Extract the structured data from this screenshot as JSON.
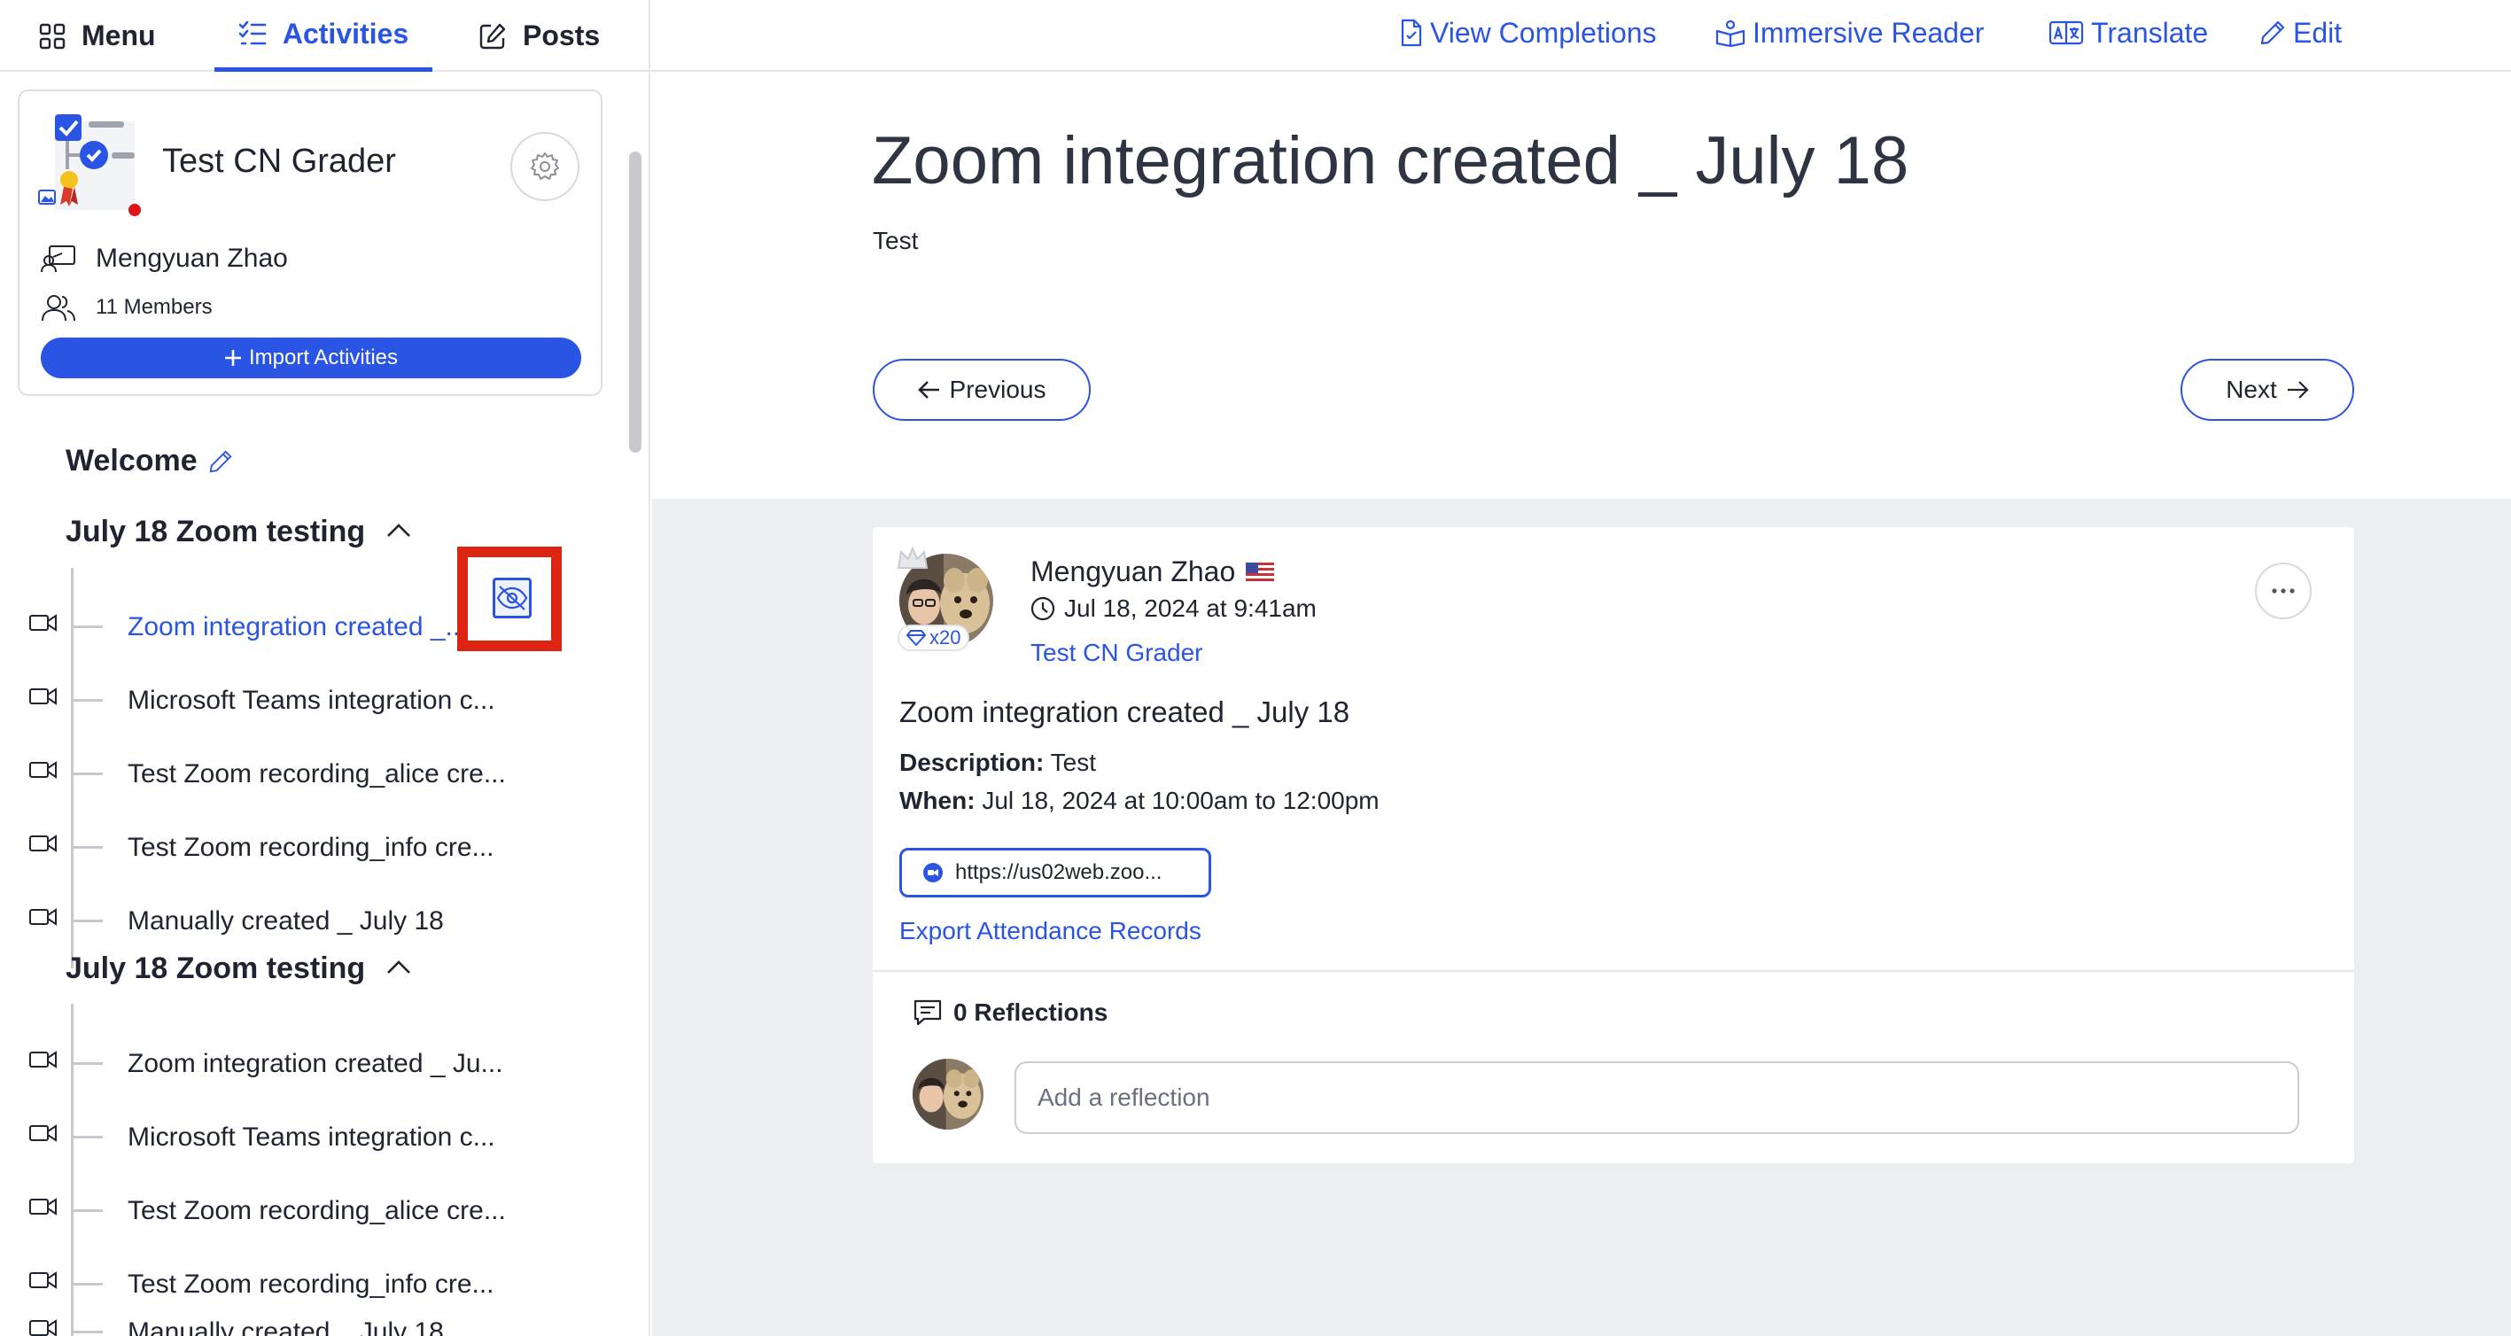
{
  "colors": {
    "accent": "#2a55e4",
    "highlight": "#dd2413",
    "muted_bg": "#eceef2",
    "text": "#1f2430"
  },
  "topbar": {
    "tabs": [
      {
        "label": "Menu",
        "icon": "grid-icon"
      },
      {
        "label": "Activities",
        "icon": "checklist-icon",
        "active": true
      },
      {
        "label": "Posts",
        "icon": "edit-square-icon"
      }
    ],
    "actions": [
      {
        "label": "View Completions",
        "icon": "document-check-icon"
      },
      {
        "label": "Immersive Reader",
        "icon": "reader-icon"
      },
      {
        "label": "Translate",
        "icon": "translate-icon"
      },
      {
        "label": "Edit",
        "icon": "pencil-icon"
      }
    ]
  },
  "sidebar": {
    "course": {
      "title": "Test CN Grader",
      "instructor": "Mengyuan Zhao",
      "members": "11 Members",
      "import_label": "Import Activities"
    },
    "welcome": "Welcome",
    "sections": [
      {
        "title": "July 18 Zoom testing",
        "items": [
          {
            "label": "Zoom integration created _...",
            "active": true,
            "hidden_toggle": true
          },
          {
            "label": "Microsoft Teams integration c..."
          },
          {
            "label": "Test Zoom recording_alice cre..."
          },
          {
            "label": "Test Zoom recording_info cre..."
          },
          {
            "label": "Manually created _ July 18"
          }
        ]
      },
      {
        "title": "July 18 Zoom testing",
        "items": [
          {
            "label": "Zoom integration created _ Ju..."
          },
          {
            "label": "Microsoft Teams integration c..."
          },
          {
            "label": "Test Zoom recording_alice cre..."
          },
          {
            "label": "Test Zoom recording_info cre..."
          },
          {
            "label": "Manually created _ July 18"
          }
        ]
      }
    ]
  },
  "main": {
    "title": "Zoom integration created _ July 18",
    "subtitle": "Test",
    "previous_label": "Previous",
    "next_label": "Next",
    "post": {
      "author": "Mengyuan Zhao",
      "flag": "us-flag-icon",
      "time": "Jul 18, 2024 at 9:41am",
      "group": "Test CN Grader",
      "gem_count": "x20",
      "title": "Zoom integration created _ July 18",
      "description_label": "Description:",
      "description": "Test",
      "when_label": "When:",
      "when": "Jul 18, 2024 at 10:00am to 12:00pm",
      "link": "https://us02web.zoo...",
      "export_label": "Export Attendance Records",
      "reflections": "0 Reflections",
      "reflection_placeholder": "Add a reflection"
    }
  }
}
